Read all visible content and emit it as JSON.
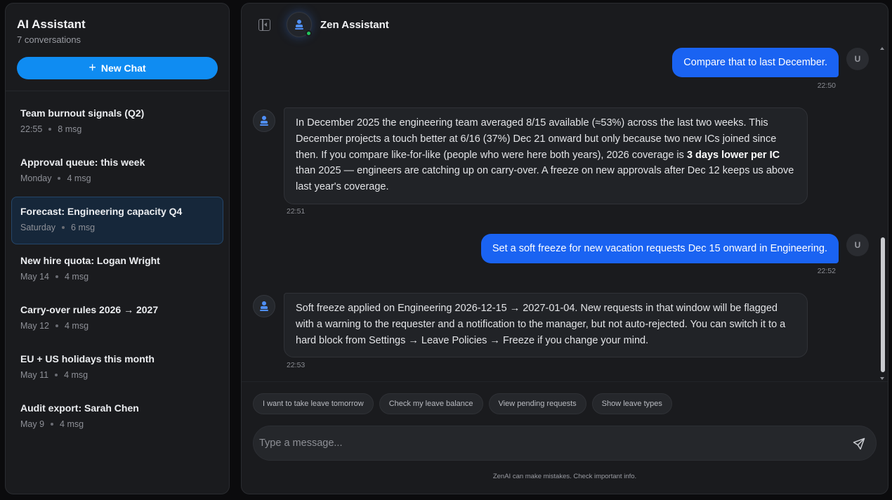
{
  "sidebar": {
    "title": "AI Assistant",
    "subtitle": "7 conversations",
    "new_chat_label": "New Chat",
    "conversations": [
      {
        "title": "Team burnout signals (Q2)",
        "time": "22:55",
        "count": "8 msg",
        "active": false
      },
      {
        "title": "Approval queue: this week",
        "time": "Monday",
        "count": "4 msg",
        "active": false
      },
      {
        "title": "Forecast: Engineering capacity Q4",
        "time": "Saturday",
        "count": "6 msg",
        "active": true
      },
      {
        "title": "New hire quota: Logan Wright",
        "time": "May 14",
        "count": "4 msg",
        "active": false
      },
      {
        "title": "Carry-over rules 2026 → 2027",
        "time": "May 12",
        "count": "4 msg",
        "active": false
      },
      {
        "title": "EU + US holidays this month",
        "time": "May 11",
        "count": "4 msg",
        "active": false
      },
      {
        "title": "Audit export: Sarah Chen",
        "time": "May 9",
        "count": "4 msg",
        "active": false
      }
    ]
  },
  "header": {
    "assistant_name": "Zen Assistant",
    "status": "online"
  },
  "messages": [
    {
      "role": "user",
      "avatar": "U",
      "text": "Compare that to last December.",
      "time": "22:50"
    },
    {
      "role": "assistant",
      "pre": "In December 2025 the engineering team averaged 8/15 available (≈53%) across the last two weeks. This December projects a touch better at 6/16 (37%) Dec 21 onward but only because two new ICs joined since then. If you compare like-for-like (people who were here both years), 2026 coverage is ",
      "bold": "3 days lower per IC",
      "post": " than 2025 — engineers are catching up on carry-over. A freeze on new approvals after Dec 12 keeps us above last year's coverage.",
      "time": "22:51"
    },
    {
      "role": "user",
      "avatar": "U",
      "text": "Set a soft freeze for new vacation requests Dec 15 onward in Engineering.",
      "time": "22:52"
    },
    {
      "role": "assistant",
      "text": "Soft freeze applied on Engineering 2026-12-15 → 2027-01-04. New requests in that window will be flagged with a warning to the requester and a notification to the manager, but not auto-rejected. You can switch it to a hard block from Settings → Leave Policies → Freeze if you change your mind.",
      "time": "22:53"
    }
  ],
  "suggestions": [
    "I want to take leave tomorrow",
    "Check my leave balance",
    "View pending requests",
    "Show leave types"
  ],
  "composer": {
    "placeholder": "Type a message..."
  },
  "footnote": "ZenAI can make mistakes. Check important info.",
  "colors": {
    "accent": "#0f8cf2",
    "user_bubble": "#1a63f2",
    "online": "#22c55e"
  }
}
